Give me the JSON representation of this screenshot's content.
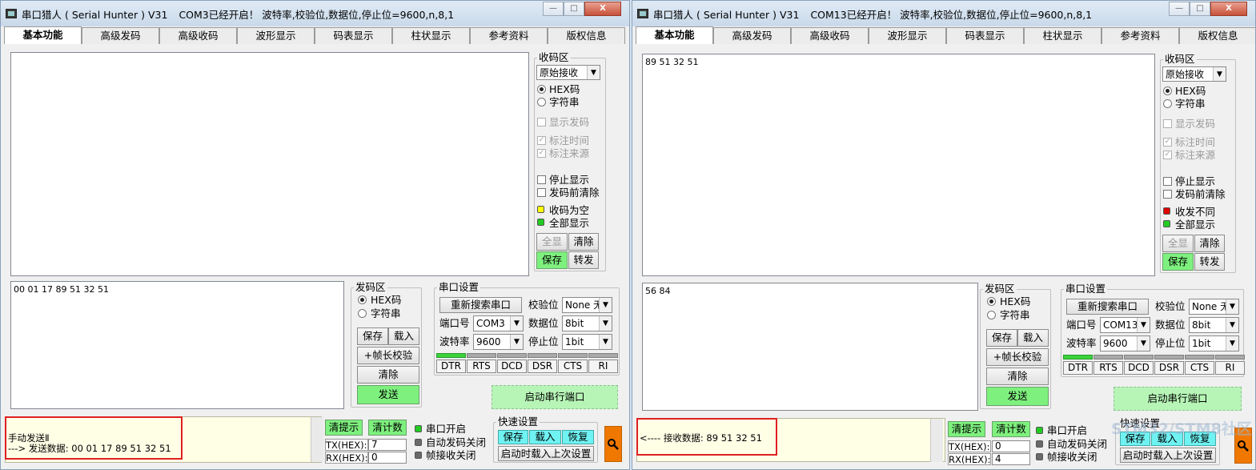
{
  "tabs": [
    "基本功能",
    "高级发码",
    "高级收码",
    "波形显示",
    "码表显示",
    "柱状显示",
    "参考资料",
    "版权信息"
  ],
  "window_buttons": {
    "minimize": "—",
    "maximize": "□",
    "close": "X"
  },
  "common": {
    "recv_group": "收码区",
    "recv_mode": "原始接收",
    "hex_label": "HEX码",
    "str_label": "字符串",
    "show_sent": "显示发码",
    "mark_time": "标注时间",
    "mark_source": "标注来源",
    "stop_display": "停止显示",
    "clear_before_send": "发码前清除",
    "all_display": "全部显示",
    "btn_full": "全显",
    "btn_clear": "清除",
    "btn_save": "保存",
    "btn_forward": "转发",
    "send_group": "发码区",
    "btn_load": "载入",
    "btn_frame": "+帧长校验",
    "btn_send": "发送",
    "port_group": "串口设置",
    "btn_rescan": "重新搜索串口",
    "parity_label": "校验位",
    "parity_value": "None 无",
    "port_label": "端口号",
    "databits_label": "数据位",
    "databits_value": "8bit",
    "baud_label": "波特率",
    "baud_value": "9600",
    "stopbits_label": "停止位",
    "stopbits_value": "1bit",
    "signals": [
      "DTR",
      "RTS",
      "DCD",
      "DSR",
      "CTS",
      "RI"
    ],
    "btn_start": "启动串行端口",
    "btn_clear_tip": "清提示",
    "btn_clear_count": "清计数",
    "tx_label": "TX(HEX):",
    "rx_label": "RX(HEX):",
    "port_open": "串口开启",
    "auto_close": "自动发码关闭",
    "frame_close": "帧接收关闭",
    "quick_group": "快速设置",
    "btn_q_save": "保存",
    "btn_q_load": "载入",
    "btn_q_restore": "恢复",
    "btn_load_last": "启动时载入上次设置"
  },
  "left": {
    "title": "串口猎人 ( Serial Hunter ) V31",
    "title_status": "COM3已经开启！ 波特率,校验位,数据位,停止位=9600,n,8,1",
    "recv_text": "",
    "send_text": "00 01 17 89 51 32 51",
    "recv_status": "收码为空",
    "port": "COM3",
    "tx_count": "7",
    "rx_count": "0",
    "status_line1": "手动发送Ⅱ",
    "status_line2": "---> 发送数据:  00 01 17 89 51 32 51",
    "colors": {
      "led_status": "#ffff00"
    }
  },
  "right": {
    "title": "串口猎人 ( Serial Hunter ) V31",
    "title_status": "COM13已经开启！ 波特率,校验位,数据位,停止位=9600,n,8,1",
    "recv_text": "89 51 32 51",
    "send_text": "56 84",
    "recv_status": "收发不同",
    "port": "COM13",
    "tx_count": "0",
    "rx_count": "4",
    "status_line1": "",
    "status_line2": "<---- 接收数据:  89 51 32 51",
    "watermark": "STM32/STM8社区",
    "colors": {
      "led_status": "#e00000"
    }
  },
  "colors": {
    "green_button": "#7ef07e",
    "cyan_button": "#6ff2f2",
    "status_bg": "#ffffe6",
    "highlight_box": "#e02020"
  }
}
